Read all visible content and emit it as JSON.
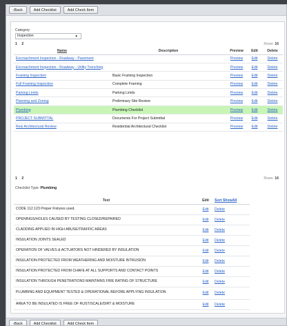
{
  "toolbar": {
    "back": "‹Back",
    "add_checklist": "Add Checklist",
    "add_check_item": "Add Check Item"
  },
  "category": {
    "label": "Category",
    "selected": "Inspection"
  },
  "pager": {
    "pages": [
      "1",
      "2"
    ]
  },
  "rows": {
    "label": "Rows:",
    "count": "16"
  },
  "checklists": {
    "columns": [
      "Name",
      "Description",
      "Preview",
      "Edit",
      "Delete"
    ],
    "rows": [
      {
        "name": "Encroachment Inspection - Roadway - Pavement",
        "description": "",
        "preview": "Preview",
        "edit": "Edit",
        "delete": "Delete"
      },
      {
        "name": "Encroachment Inspection - Roadway - Utility Trenching",
        "description": "",
        "preview": "Preview",
        "edit": "Edit",
        "delete": "Delete"
      },
      {
        "name": "Framing Inspection",
        "description": "Basic Framing Inspection",
        "preview": "Preview",
        "edit": "Edit",
        "delete": "Delete"
      },
      {
        "name": "Full Framing Inspection",
        "description": "Complete Framing",
        "preview": "Preview",
        "edit": "Edit",
        "delete": "Delete"
      },
      {
        "name": "Parking Limits",
        "description": "Parking Limits",
        "preview": "Preview",
        "edit": "Edit",
        "delete": "Delete"
      },
      {
        "name": "Planning and Zoning",
        "description": "Preliminary Site Review",
        "preview": "Preview",
        "edit": "Edit",
        "delete": "Delete"
      },
      {
        "name": "Plumbing",
        "description": "Plumbing Checklist",
        "preview": "Preview",
        "edit": "Edit",
        "delete": "Delete"
      },
      {
        "name": "PROJECT SUBMITTAL",
        "description": "Documents For Project Submittal",
        "preview": "Preview",
        "edit": "Edit",
        "delete": "Delete"
      },
      {
        "name": "Resi Architectural Review",
        "description": "Residential Architectural Checklist",
        "preview": "Preview",
        "edit": "Edit",
        "delete": "Delete"
      }
    ]
  },
  "checklist_type": {
    "label": "Checklist Type:",
    "value": "Plumbing"
  },
  "items": {
    "columns": {
      "text": "Text",
      "edit": "Edit",
      "sort": "Sort ShowAll"
    },
    "rows": [
      {
        "text": "CODE 112.123 Proper Fixtures used.",
        "edit": "Edit",
        "delete": "Delete"
      },
      {
        "text": "OPENINGS/HOLES CAUSED BY TESTING CLOSED/REPAIRED",
        "edit": "Edit",
        "delete": "Delete"
      },
      {
        "text": "CLADDING APPLIED IN HIGH ABUSE/TRAFFIC AREAS",
        "edit": "Edit",
        "delete": "Delete"
      },
      {
        "text": "INSULATION JOINTS SEALED",
        "edit": "Edit",
        "delete": "Delete"
      },
      {
        "text": "OPERATION OF VALVES & ACTUATORS NOT HINDERED BY INSULATION",
        "edit": "Edit",
        "delete": "Delete"
      },
      {
        "text": "INSULATION PROTECTED FROM WEATHERING AND MOISTURE INTRUSION",
        "edit": "Edit",
        "delete": "Delete"
      },
      {
        "text": "INSULATION PROTECTED FROM CHAFE AT ALL SUPPORTS AND CONTACT POINTS",
        "edit": "Edit",
        "delete": "Delete"
      },
      {
        "text": "INSULATION THROUGH PENETRATIONS MAINTAINS FIRE RATING OF STRUCTURE",
        "edit": "Edit",
        "delete": "Delete"
      },
      {
        "text": "PLUMBING AND EQUIPMENT TESTED & OPERATIONAL BEFORE APPLYING INSULATION",
        "edit": "Edit",
        "delete": "Delete"
      },
      {
        "text": "AREA TO BE INSULATED IS FREE OF RUST/SCALE/DIRT & MOISTURE",
        "edit": "Edit",
        "delete": "Delete"
      }
    ]
  },
  "colors": {
    "highlight_row": "#c8f5b6",
    "link": "#2a63c7"
  }
}
